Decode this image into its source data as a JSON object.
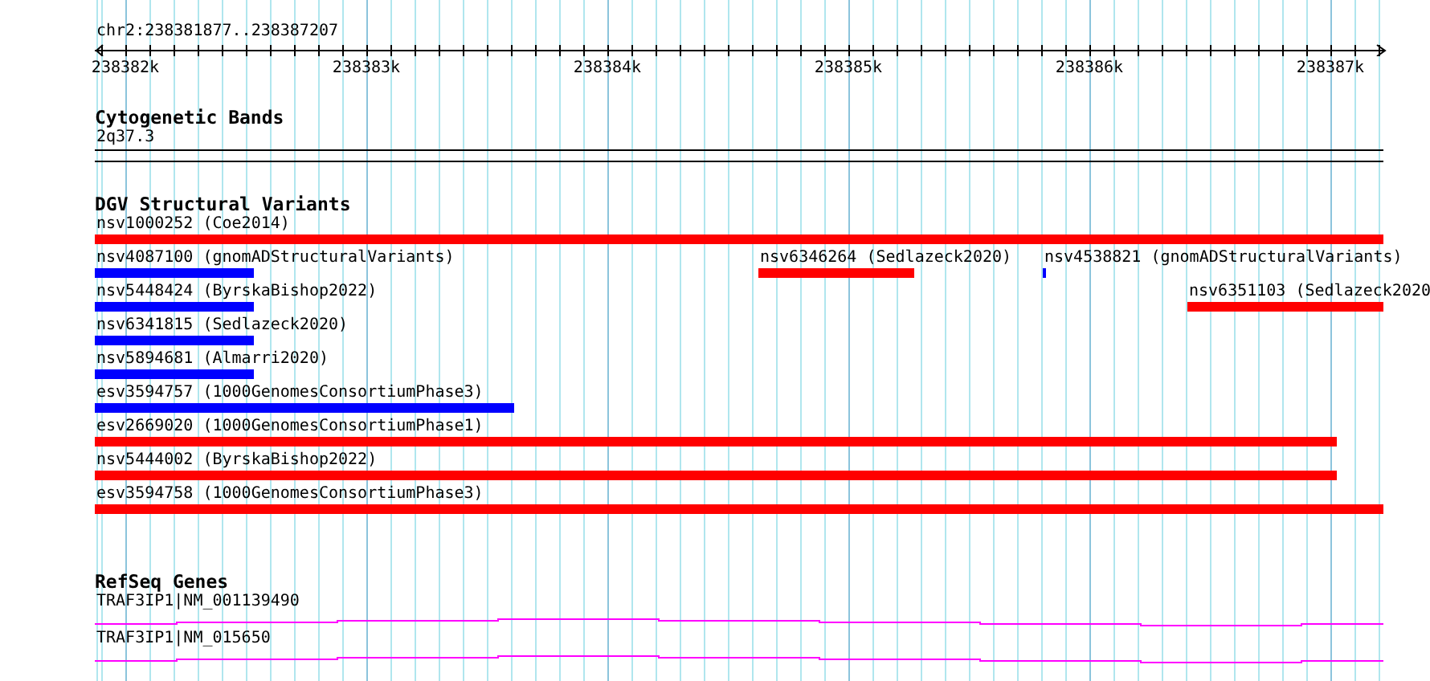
{
  "ruler": {
    "title": "chr2:238381877..238387207",
    "ticks": [
      "238382k",
      "238383k",
      "238384k",
      "238385k",
      "238386k",
      "238387k"
    ]
  },
  "cytogenetic_bands": {
    "title": "Cytogenetic Bands",
    "band": "2q37.3"
  },
  "dgv_structural_variants": {
    "title": "DGV Structural Variants",
    "variants": [
      {
        "label": "nsv1000252 (Coe2014)",
        "color": "#ff0000"
      },
      {
        "label": "nsv4087100 (gnomADStructuralVariants)",
        "color": "#0000ff"
      },
      {
        "label": "nsv6346264 (Sedlazeck2020)",
        "color": "#ff0000"
      },
      {
        "label": "nsv4538821 (gnomADStructuralVariants)",
        "color": "#0000ff"
      },
      {
        "label": "nsv5448424 (ByrskaBishop2022)",
        "color": "#0000ff"
      },
      {
        "label": "nsv6351103 (Sedlazeck2020",
        "color": "#ff0000"
      },
      {
        "label": "nsv6341815 (Sedlazeck2020)",
        "color": "#0000ff"
      },
      {
        "label": "nsv5894681 (Almarri2020)",
        "color": "#0000ff"
      },
      {
        "label": "esv3594757 (1000GenomesConsortiumPhase3)",
        "color": "#0000ff"
      },
      {
        "label": "esv2669020 (1000GenomesConsortiumPhase1)",
        "color": "#ff0000"
      },
      {
        "label": "nsv5444002 (ByrskaBishop2022)",
        "color": "#ff0000"
      },
      {
        "label": "esv3594758 (1000GenomesConsortiumPhase3)",
        "color": "#ff0000"
      }
    ]
  },
  "refseq_genes": {
    "title": "RefSeq Genes",
    "genes": [
      {
        "label": "TRAF3IP1|NM_001139490"
      },
      {
        "label": "TRAF3IP1|NM_015650"
      }
    ]
  }
}
